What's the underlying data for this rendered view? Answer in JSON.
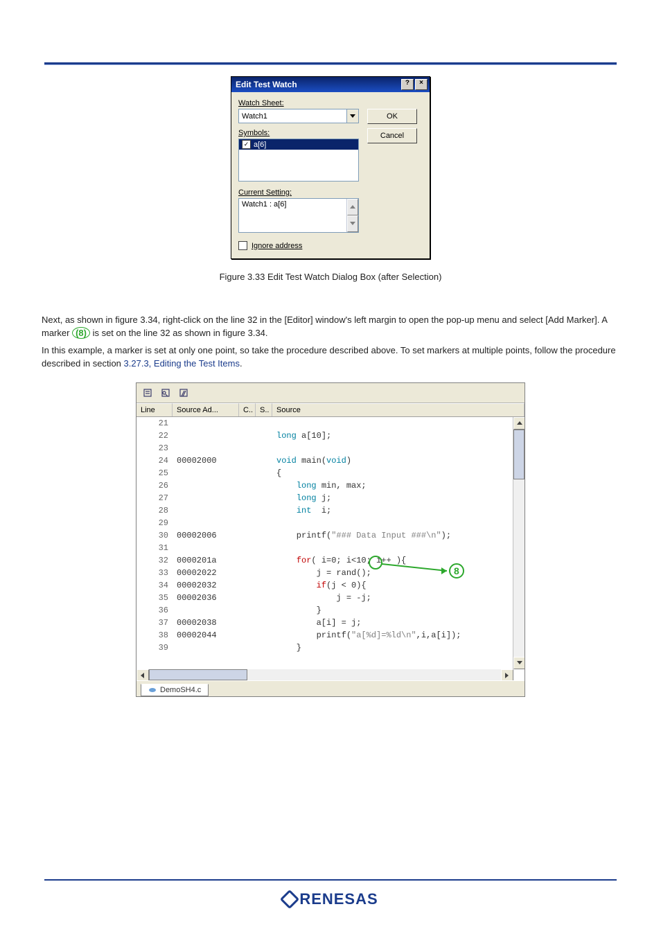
{
  "dialog": {
    "title": "Edit Test Watch",
    "help_glyph": "?",
    "close_glyph": "×",
    "watch_sheet_label": "Watch Sheet:",
    "watch_sheet_value": "Watch1",
    "symbols_label": "Symbols:",
    "symbol_selected": "a[6]",
    "current_setting_label": "Current Setting:",
    "current_setting_value": "Watch1 : a[6]",
    "ignore_address_label": "Ignore address",
    "ok_label": "OK",
    "cancel_label": "Cancel"
  },
  "fig1": "Figure 3.33   Edit Test Watch Dialog Box (after Selection)",
  "paragraphs": {
    "p1a": "Next, as shown in figure 3.34, right-click on the line 32 in the [Editor] window's left margin to open the pop-up menu and select [Add Marker].",
    "p1b": " A marker ",
    "p1c": "(8)",
    "p1d": " is set on the line 32 as shown in figure 3.34.",
    "p2": "In this example, a marker is set at only one point, so take the procedure described above. To set markers at multiple points, follow the procedure described in section",
    "p2_link": "3.27.3, Editing the Test Items",
    "p2_end": "."
  },
  "code_window": {
    "headers": [
      "Line",
      "Source Ad...",
      "C..",
      "S..",
      "Source"
    ],
    "tab_label": "DemoSH4.c",
    "rows": [
      {
        "line": "21",
        "addr": "",
        "src_tokens": [
          [
            "",
            ""
          ]
        ]
      },
      {
        "line": "22",
        "addr": "",
        "src_tokens": [
          [
            "type",
            "long"
          ],
          [
            "",
            " a["
          ],
          [
            "",
            "10"
          ],
          [
            "",
            "];"
          ]
        ]
      },
      {
        "line": "23",
        "addr": "",
        "src_tokens": [
          [
            "",
            ""
          ]
        ]
      },
      {
        "line": "24",
        "addr": "00002000",
        "src_tokens": [
          [
            "type",
            "void"
          ],
          [
            "",
            " main("
          ],
          [
            "type",
            "void"
          ],
          [
            "",
            ")"
          ]
        ]
      },
      {
        "line": "25",
        "addr": "",
        "src_tokens": [
          [
            "",
            "{"
          ]
        ]
      },
      {
        "line": "26",
        "addr": "",
        "src_tokens": [
          [
            "",
            "    "
          ],
          [
            "type",
            "long"
          ],
          [
            "",
            " min, max;"
          ]
        ]
      },
      {
        "line": "27",
        "addr": "",
        "src_tokens": [
          [
            "",
            "    "
          ],
          [
            "type",
            "long"
          ],
          [
            "",
            " j;"
          ]
        ]
      },
      {
        "line": "28",
        "addr": "",
        "src_tokens": [
          [
            "",
            "    "
          ],
          [
            "type",
            "int"
          ],
          [
            "",
            "  i;"
          ]
        ]
      },
      {
        "line": "29",
        "addr": "",
        "src_tokens": [
          [
            "",
            ""
          ]
        ]
      },
      {
        "line": "30",
        "addr": "00002006",
        "src_tokens": [
          [
            "",
            "    printf("
          ],
          [
            "str",
            "\"### Data Input ###\\n\""
          ],
          [
            "",
            ");"
          ]
        ]
      },
      {
        "line": "31",
        "addr": "",
        "src_tokens": [
          [
            "",
            ""
          ]
        ]
      },
      {
        "line": "32",
        "addr": "0000201a",
        "src_tokens": [
          [
            "",
            "    "
          ],
          [
            "ctrl",
            "for"
          ],
          [
            "",
            "( i="
          ],
          [
            "",
            "0"
          ],
          [
            "",
            "; i<"
          ],
          [
            "",
            "10"
          ],
          [
            "",
            "; i++ ){"
          ]
        ]
      },
      {
        "line": "33",
        "addr": "00002022",
        "src_tokens": [
          [
            "",
            "        j = rand();"
          ]
        ]
      },
      {
        "line": "34",
        "addr": "00002032",
        "src_tokens": [
          [
            "",
            "        "
          ],
          [
            "ctrl",
            "if"
          ],
          [
            "",
            "(j < "
          ],
          [
            "",
            "0"
          ],
          [
            "",
            "){"
          ]
        ]
      },
      {
        "line": "35",
        "addr": "00002036",
        "src_tokens": [
          [
            "",
            "            j = -j;"
          ]
        ]
      },
      {
        "line": "36",
        "addr": "",
        "src_tokens": [
          [
            "",
            "        }"
          ]
        ]
      },
      {
        "line": "37",
        "addr": "00002038",
        "src_tokens": [
          [
            "",
            "        a[i] = j;"
          ]
        ]
      },
      {
        "line": "38",
        "addr": "00002044",
        "src_tokens": [
          [
            "",
            "        printf("
          ],
          [
            "str",
            "\"a[%d]=%ld\\n\""
          ],
          [
            "",
            ",i,a[i]);"
          ]
        ]
      },
      {
        "line": "39",
        "addr": "",
        "src_tokens": [
          [
            "",
            "    }"
          ]
        ]
      }
    ],
    "annotation_label": "8"
  },
  "logo_text": "RENESAS"
}
